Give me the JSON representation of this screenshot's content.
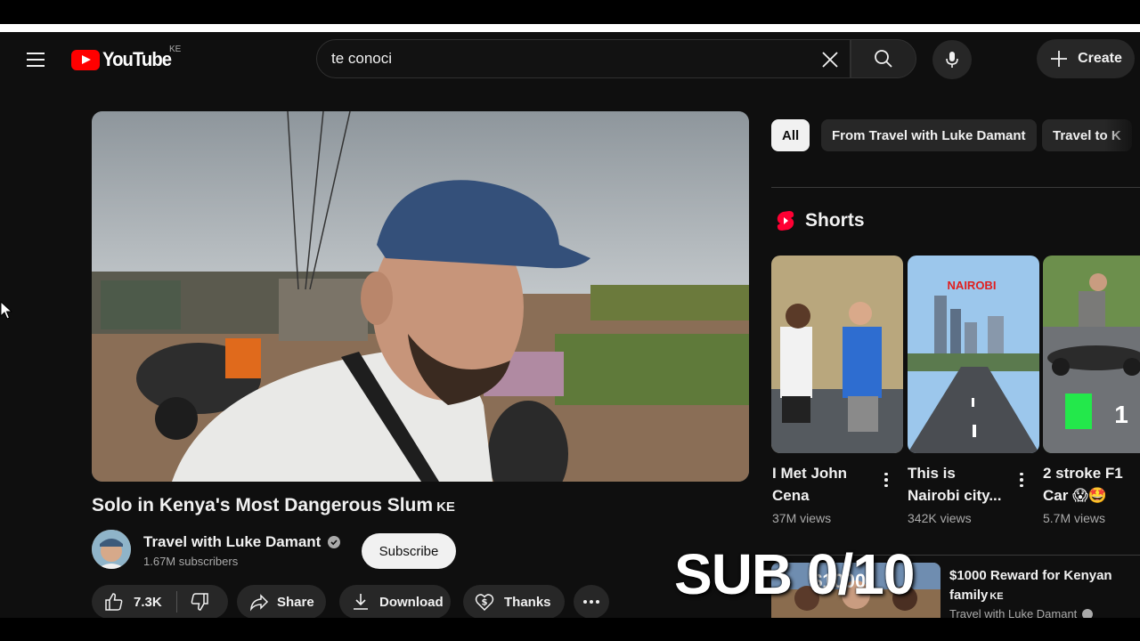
{
  "header": {
    "logo_text": "YouTube",
    "country_code": "KE",
    "search_value": "te conoci",
    "create_label": "Create"
  },
  "video": {
    "title": "Solo in Kenya's Most Dangerous Slum",
    "title_suffix": "KE",
    "channel_name": "Travel with Luke Damant",
    "subscribers": "1.67M subscribers",
    "subscribe_label": "Subscribe",
    "likes": "7.3K",
    "share_label": "Share",
    "download_label": "Download",
    "thanks_label": "Thanks"
  },
  "chips": [
    "All",
    "From Travel with Luke Damant",
    "Travel to K"
  ],
  "shorts": {
    "heading": "Shorts",
    "items": [
      {
        "title": "I Met John Cena",
        "views": "37M views"
      },
      {
        "title": "This is Nairobi city...",
        "views": "342K views",
        "thumb_text": "NAIROBI"
      },
      {
        "title": "2 stroke F1 Car 😱🤩",
        "views": "5.7M views",
        "thumb_text": "1"
      }
    ]
  },
  "recommended": {
    "title": "$1000 Reward for Kenyan family",
    "title_suffix": "KE",
    "channel": "Travel with Luke Damant",
    "thumb_text": "$1000"
  },
  "overlay": {
    "text": "SUB 0/10"
  },
  "colors": {
    "background": "#0f0f0f",
    "brand_red": "#ff0000",
    "button_gray": "#272727",
    "text_primary": "#f1f1f1",
    "text_secondary": "#aaaaaa"
  }
}
